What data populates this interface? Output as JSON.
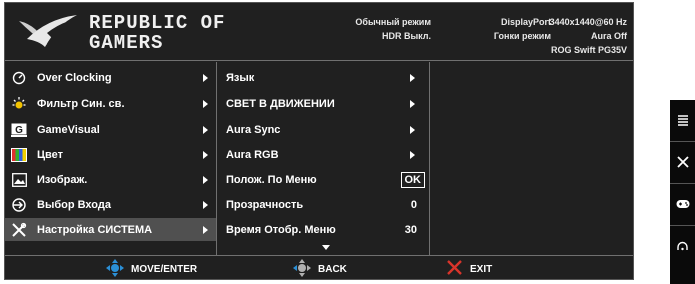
{
  "header": {
    "brand_line1": "REPUBLIC OF",
    "brand_line2": "GAMERS",
    "status": [
      {
        "line1": "Обычный режим",
        "line2": "HDR Выкл.",
        "line3": ""
      },
      {
        "line1": "DisplayPort",
        "line2": "Гонки режим",
        "line3": ""
      },
      {
        "line1": "3440x1440@60 Hz",
        "line2": "Aura Off",
        "line3": "ROG Swift PG35V"
      }
    ]
  },
  "main_menu": [
    {
      "label": "Over Clocking",
      "icon": "gauge-icon"
    },
    {
      "label": "Фильтр Син. св.",
      "icon": "sun-icon"
    },
    {
      "label": "GameVisual",
      "icon": "gamevisual-icon"
    },
    {
      "label": "Цвет",
      "icon": "color-bars-icon"
    },
    {
      "label": "Изображ.",
      "icon": "image-icon"
    },
    {
      "label": "Выбор Входа",
      "icon": "input-icon"
    },
    {
      "label": "Настройка СИСТЕМА",
      "icon": "tools-icon",
      "selected": true
    }
  ],
  "sub_menu": [
    {
      "label": "Язык",
      "value": "",
      "arrow": true
    },
    {
      "label": "СВЕТ В ДВИЖЕНИИ",
      "value": "",
      "arrow": true
    },
    {
      "label": "Aura Sync",
      "value": "",
      "arrow": true
    },
    {
      "label": "Aura RGB",
      "value": "",
      "arrow": true
    },
    {
      "label": "Полож. По  Меню",
      "value": "OK",
      "arrow": false
    },
    {
      "label": "Прозрачность",
      "value": "0",
      "arrow": false
    },
    {
      "label": "Время Отобр. Меню",
      "value": "30",
      "arrow": false
    }
  ],
  "footer": {
    "move_enter": "MOVE/ENTER",
    "back": "BACK",
    "exit": "EXIT"
  },
  "side_buttons": [
    "menu-icon",
    "close-icon",
    "gamepad-icon",
    "power-icon"
  ],
  "colors": {
    "accent_blue": "#2b8fd6",
    "exit_red": "#d9342b",
    "background": "#202020",
    "selected": "#505050"
  }
}
